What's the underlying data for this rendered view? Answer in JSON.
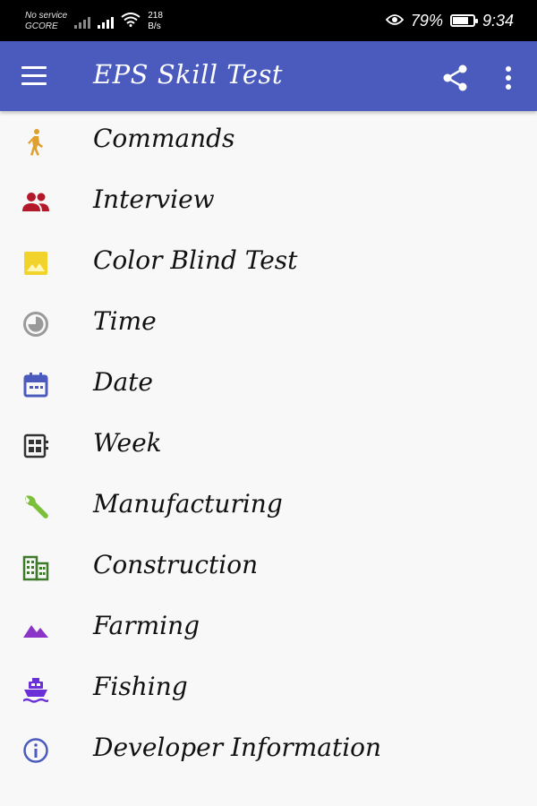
{
  "status_bar": {
    "carrier_line1": "No service",
    "carrier_line2": "GCORE",
    "speed_value": "218",
    "speed_unit": "B/s",
    "battery": "79%",
    "battery_level": 0.79,
    "time": "9:34"
  },
  "app_bar": {
    "title": "EPS Skill Test",
    "color": "#4a5bbd"
  },
  "menu": {
    "items": [
      {
        "label": "Commands",
        "icon": "walking-person-icon",
        "color": "#e0a030"
      },
      {
        "label": "Interview",
        "icon": "people-icon",
        "color": "#b3192a"
      },
      {
        "label": "Color Blind Test",
        "icon": "image-icon",
        "color": "#f2d32c"
      },
      {
        "label": "Time",
        "icon": "clock-icon",
        "color": "#9a9a9a"
      },
      {
        "label": "Date",
        "icon": "calendar-icon",
        "color": "#4a5bbd"
      },
      {
        "label": "Week",
        "icon": "week-grid-icon",
        "color": "#333333"
      },
      {
        "label": "Manufacturing",
        "icon": "wrench-icon",
        "color": "#7bbf3a"
      },
      {
        "label": "Construction",
        "icon": "building-icon",
        "color": "#3d7a2a"
      },
      {
        "label": "Farming",
        "icon": "landscape-icon",
        "color": "#8a35c8"
      },
      {
        "label": "Fishing",
        "icon": "boat-icon",
        "color": "#6a2fd6"
      },
      {
        "label": "Developer Information",
        "icon": "info-icon",
        "color": "#4a5bbd"
      }
    ]
  }
}
